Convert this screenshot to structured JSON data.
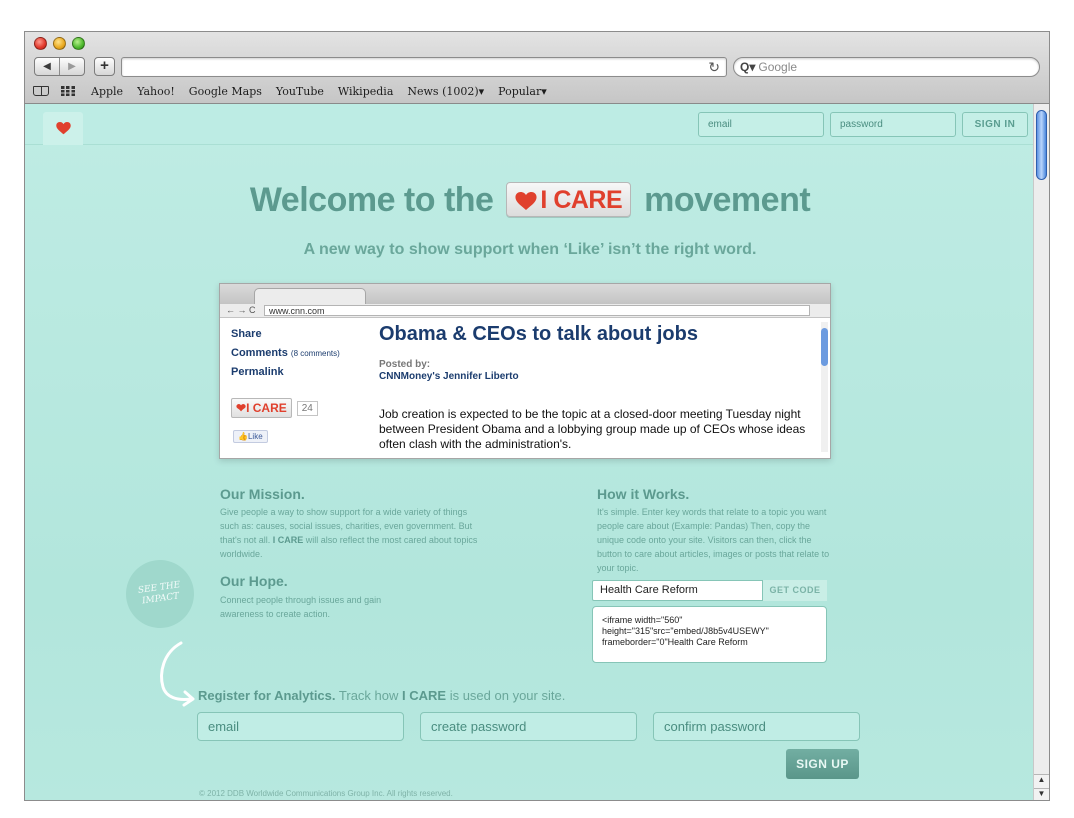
{
  "browser": {
    "nav_back": "◀",
    "nav_forward": "▶",
    "new_tab": "+",
    "reload_icon": "↻",
    "search_placeholder": "Google",
    "bookmarks": [
      "Apple",
      "Yahoo!",
      "Google Maps",
      "YouTube",
      "Wikipedia",
      "News (1002)▾",
      "Popular▾"
    ]
  },
  "header": {
    "email_placeholder": "email",
    "password_placeholder": "password",
    "signin_label": "SIGN IN"
  },
  "hero": {
    "title_before": "Welcome to the",
    "badge_text": "I CARE",
    "title_after": "movement",
    "subtitle": "A new way to show support when ‘Like’ isn’t the right word."
  },
  "mini_browser": {
    "url": "www.cnn.com",
    "nav": "← → C",
    "sidebar": {
      "share": "Share",
      "comments": "Comments",
      "comments_count": "(8 comments)",
      "permalink": "Permalink"
    },
    "icare_badge": "I CARE",
    "icare_count": "24",
    "like_label": "Like",
    "headline": "Obama & CEOs to talk about jobs",
    "posted_by": "Posted by:",
    "author": "CNNMoney's Jennifer Liberto",
    "body": "Job creation is expected to be the topic at a closed-door meeting Tuesday night between President Obama and a lobbying group made up of CEOs whose ideas often clash with the administration's."
  },
  "mission": {
    "heading": "Our Mission.",
    "text_1": "Give people a way to show support for a wide variety of things such as: causes, social issues, charities, even government. But that's not all.",
    "brand": "I CARE",
    "text_2": "will also reflect the most cared about topics worldwide."
  },
  "hope": {
    "heading": "Our Hope.",
    "text": "Connect people through issues and gain awareness to create action."
  },
  "impact_badge": "SEE THE IMPACT",
  "how": {
    "heading": "How it Works.",
    "text": "It's simple. Enter key words that relate to a topic you want people care about (Example: Pandas) Then, copy the unique code onto your site. Visitors can then, click the button to care about articles, images or posts that relate to your topic.",
    "topic_value": "Health Care Reform",
    "get_code_label": "GET CODE",
    "code": "<iframe width=\"560\" height=\"315\"src=\"embed/J8b5v4USEWY\" frameborder=\"0\"Health Care Reform"
  },
  "register": {
    "heading": "Register for Analytics.",
    "text_before": "Track how",
    "brand": "I CARE",
    "text_after": "is used on your site.",
    "email_placeholder": "email",
    "password_placeholder": "create password",
    "confirm_placeholder": "confirm password",
    "signup_label": "SIGN UP"
  },
  "footer": {
    "copyright": "© 2012 DDB Worldwide Communications Group Inc. All rights reserved."
  },
  "colors": {
    "background": "#b9e8df",
    "accent": "#5c9a8f",
    "heart": "#e0402d",
    "link": "#1b3c6e"
  }
}
